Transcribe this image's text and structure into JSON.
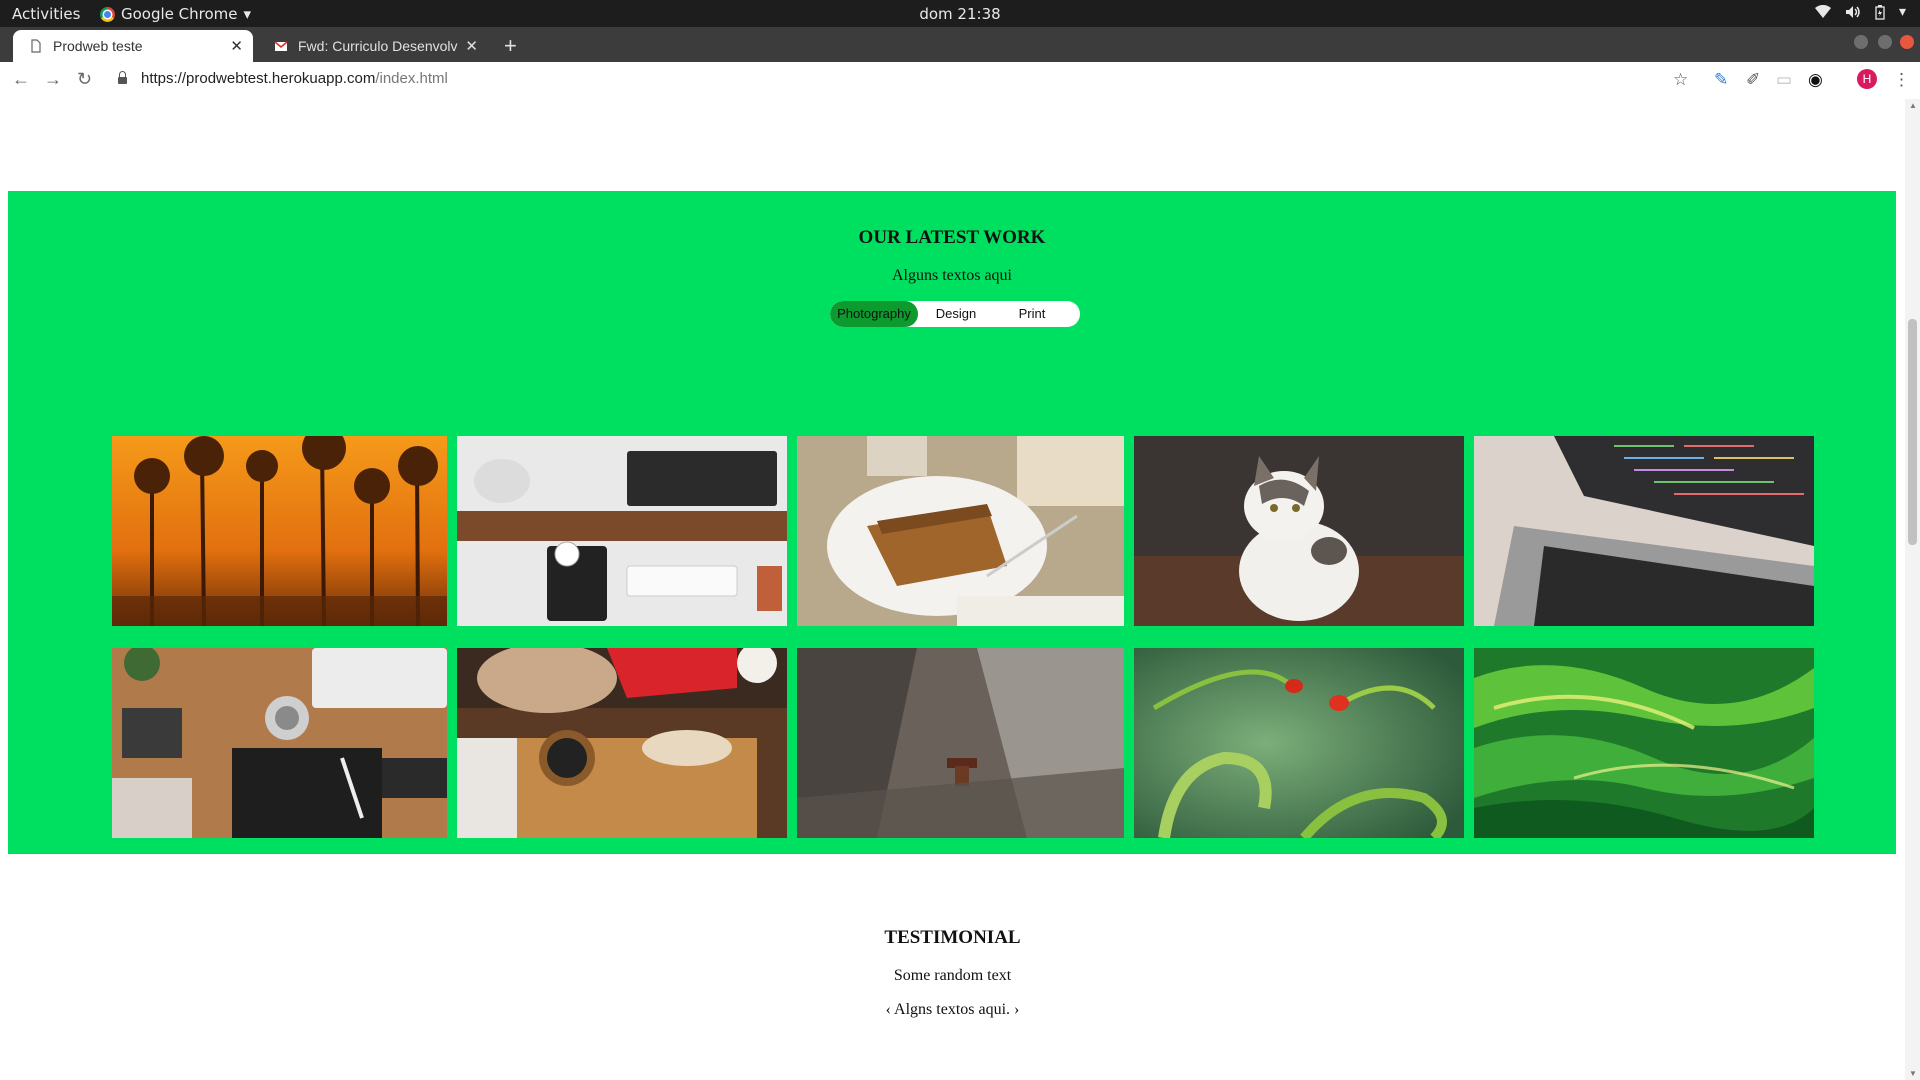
{
  "system": {
    "activities": "Activities",
    "app_name": "Google Chrome",
    "clock": "dom 21:38"
  },
  "browser": {
    "tabs": [
      {
        "title": "Prodweb teste",
        "active": true
      },
      {
        "title": "Fwd: Curriculo Desenvolv",
        "active": false
      }
    ],
    "url": {
      "scheme": "https://",
      "host": "prodwebtest.herokuapp.com",
      "path": "/index.html"
    },
    "profile_initial": "H"
  },
  "work_section": {
    "title": "OUR LATEST WORK",
    "subtitle": "Alguns textos aqui",
    "filters": [
      {
        "label": "Photography",
        "selected": true
      },
      {
        "label": "Design",
        "selected": false
      },
      {
        "label": "Print",
        "selected": false
      }
    ],
    "accent_color": "#00e060",
    "selected_filter_color": "#0d9a2f",
    "gallery": [
      {
        "name": "sunset-trees-photo"
      },
      {
        "name": "desk-keyboard-photo"
      },
      {
        "name": "cake-coffee-photo"
      },
      {
        "name": "kitten-photo"
      },
      {
        "name": "laptop-code-photo"
      },
      {
        "name": "desk-notebook-photo"
      },
      {
        "name": "bread-spices-photo"
      },
      {
        "name": "wood-nail-photo"
      },
      {
        "name": "ladybugs-photo"
      },
      {
        "name": "green-abstract-photo"
      }
    ]
  },
  "testimonial_section": {
    "title": "TESTIMONIAL",
    "subtitle": "Some random text",
    "quote": "‹ Algns textos aqui. ›"
  }
}
